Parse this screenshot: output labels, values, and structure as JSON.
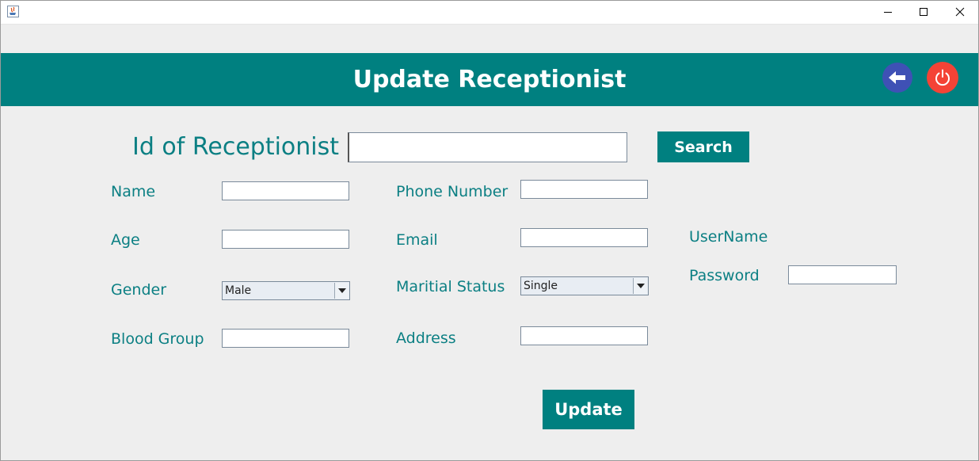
{
  "window": {
    "icon": "java-app-icon",
    "controls": [
      "minimize-icon",
      "maximize-icon",
      "close-icon"
    ]
  },
  "header": {
    "title": "Update Receptionist",
    "back_icon": "arrow-left-icon",
    "power_icon": "power-icon"
  },
  "search": {
    "label": "Id of Receptionist",
    "value": "",
    "button": "Search"
  },
  "form": {
    "name_label": "Name",
    "name_value": "",
    "age_label": "Age",
    "age_value": "",
    "gender_label": "Gender",
    "gender_value": "Male",
    "blood_group_label": "Blood Group",
    "blood_group_value": "",
    "phone_label": "Phone Number",
    "phone_value": "",
    "email_label": "Email",
    "email_value": "",
    "marital_label": "Maritial Status",
    "marital_value": "Single",
    "address_label": "Address",
    "address_value": "",
    "username_label": "UserName",
    "password_label": "Password",
    "password_value": ""
  },
  "actions": {
    "update": "Update"
  },
  "colors": {
    "teal": "#008080",
    "label": "#0b7f83",
    "back_button": "#3f51b5",
    "power_button": "#f44336",
    "background": "#eeeeee"
  }
}
